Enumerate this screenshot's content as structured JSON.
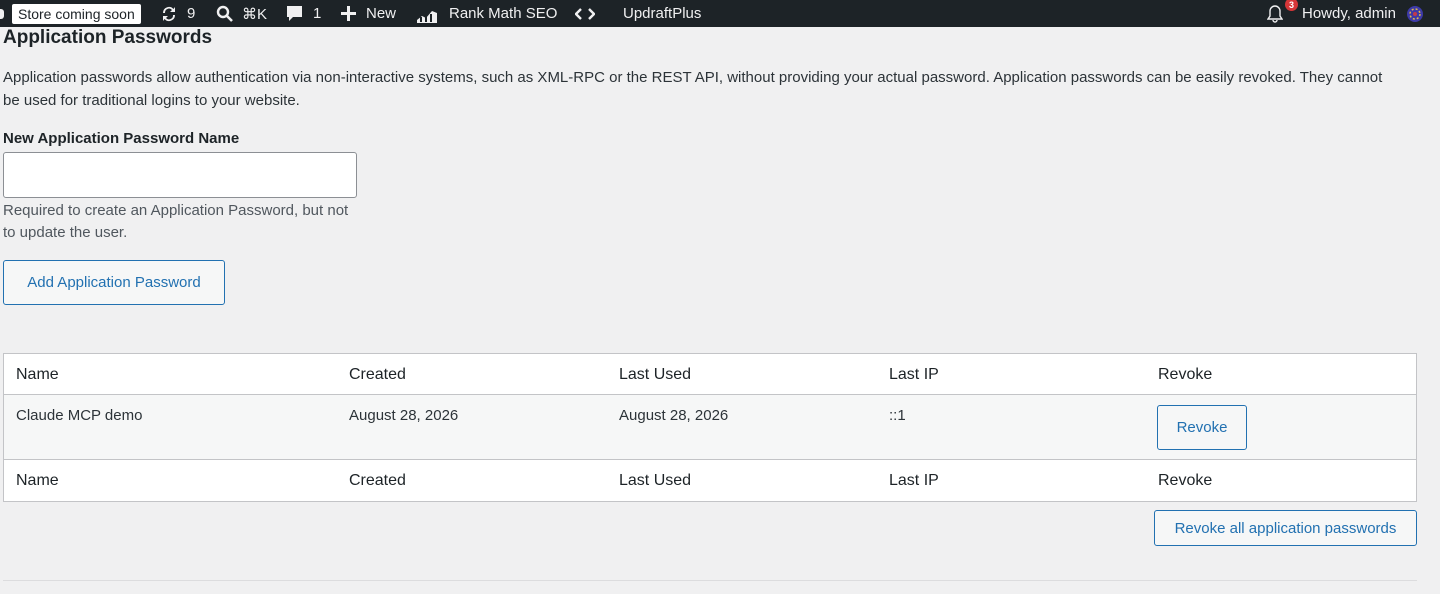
{
  "adminbar": {
    "store_badge": "Store coming soon",
    "updates_count": "9",
    "search_shortcut": "⌘K",
    "comments_count": "1",
    "new_label": "New",
    "rank_math_label": "Rank Math SEO",
    "updraft_label": "UpdraftPlus",
    "notifications_count": "3",
    "howdy_label": "Howdy, admin"
  },
  "section": {
    "title": "Application Passwords",
    "description": "Application passwords allow authentication via non-interactive systems, such as XML-RPC or the REST API, without providing your actual password. Application passwords can be easily revoked. They cannot be used for traditional logins to your website.",
    "field_label": "New Application Password Name",
    "input_value": "",
    "help_text": "Required to create an Application Password, but not to update the user.",
    "add_button": "Add Application Password"
  },
  "table": {
    "columns": [
      "Name",
      "Created",
      "Last Used",
      "Last IP",
      "Revoke"
    ],
    "rows": [
      {
        "name": "Claude MCP demo",
        "created": "August 28, 2026",
        "last_used": "August 28, 2026",
        "last_ip": "::1",
        "revoke_label": "Revoke"
      }
    ]
  },
  "revoke_all_button": "Revoke all application passwords"
}
